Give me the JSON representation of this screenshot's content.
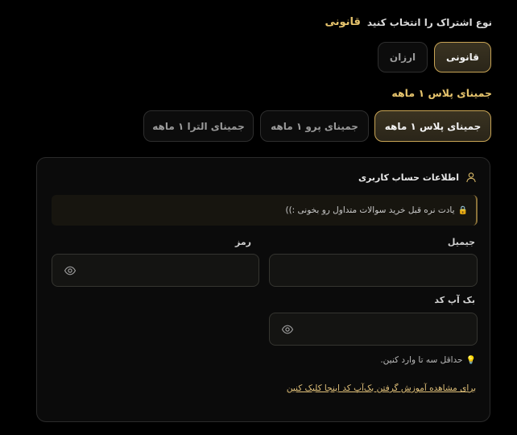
{
  "subscription": {
    "heading": "نوع اشتراک را انتخاب کنید",
    "selected_label": "قانونی",
    "options": [
      "قانونی",
      "ارزان"
    ]
  },
  "plan": {
    "heading": "جمینای پلاس ۱ ماهه",
    "options": [
      "جمینای پلاس ۱ ماهه",
      "جمینای پرو ۱ ماهه",
      "جمینای الترا ۱ ماهه"
    ]
  },
  "account": {
    "title": "اطلاعات حساب کاربری",
    "notice_icon": "🔒",
    "notice_text": "یادت نره قبل خرید سوالات متداول رو بخونی :))",
    "email_label": "جیمیل",
    "password_label": "رمز",
    "backup_label": "بک آپ کد",
    "hint_icon": "💡",
    "hint_text": "حداقل سه تا وارد کنین.",
    "tutorial_link": "برای مشاهده آموزش گرفتن بک‌آپ کد اینجا کلیک کنین"
  },
  "colors": {
    "accent": "#e6c46d",
    "active_border": "#c8a455",
    "background": "#000000",
    "card": "#0b0b0b"
  },
  "icons": {
    "user": "user-icon",
    "eye": "eye-icon",
    "lock": "lock-icon",
    "bulb": "lightbulb-icon"
  }
}
